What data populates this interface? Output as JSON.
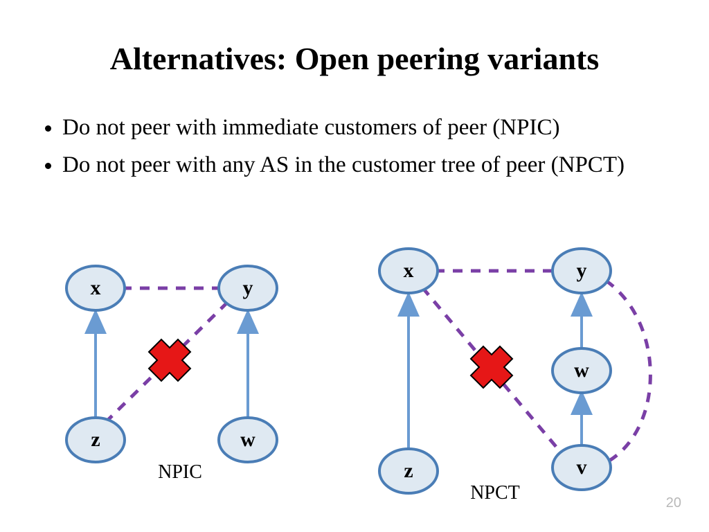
{
  "title": "Alternatives: Open peering variants",
  "bullets": [
    "Do not peer with immediate customers of peer (NPIC)",
    "Do not peer with any AS in the customer tree of peer (NPCT)"
  ],
  "page_number": "20",
  "diagrams": {
    "left": {
      "caption": "NPIC",
      "nodes": {
        "x": "x",
        "y": "y",
        "z": "z",
        "w": "w"
      }
    },
    "right": {
      "caption": "NPCT",
      "nodes": {
        "x": "x",
        "y": "y",
        "z": "z",
        "w": "w",
        "v": "v"
      }
    }
  }
}
